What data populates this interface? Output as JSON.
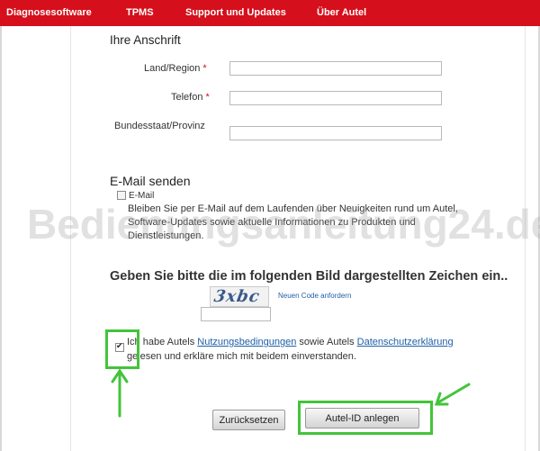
{
  "nav": {
    "items": [
      "Diagnosesoftware",
      "TPMS",
      "Support und Updates",
      "Über Autel"
    ]
  },
  "address": {
    "title": "Ihre Anschrift",
    "country_label": "Land/Region",
    "phone_label": "Telefon",
    "state_label": "Bundesstaat/Provinz",
    "required_mark": "*"
  },
  "email": {
    "title": "E-Mail senden",
    "checkbox_label": "E-Mail",
    "description": "Bleiben Sie per E-Mail auf dem Laufenden über Neuigkeiten rund um Autel, Software-Updates sowie aktuelle Informationen zu Produkten und Dienstleistungen."
  },
  "captcha": {
    "title": "Geben Sie bitte die im folgenden Bild dargestellten Zeichen ein..",
    "image_text": "3xbc",
    "new_code_link": "Neuen Code anfordern"
  },
  "agreement": {
    "text_1": "Ich habe Autels ",
    "terms_link": "Nutzungsbedingungen",
    "text_2": " sowie Autels ",
    "privacy_link": "Datenschutzerklärung",
    "text_3": " gelesen und erkläre mich mit beidem einverstanden.",
    "checked": true
  },
  "buttons": {
    "reset": "Zurücksetzen",
    "create": "Autel-ID anlegen"
  },
  "watermark": "Bedienungsanleitung24.de",
  "colors": {
    "nav_red": "#d50f1b",
    "highlight_green": "#43c43a",
    "link_blue": "#1f5fa8"
  }
}
